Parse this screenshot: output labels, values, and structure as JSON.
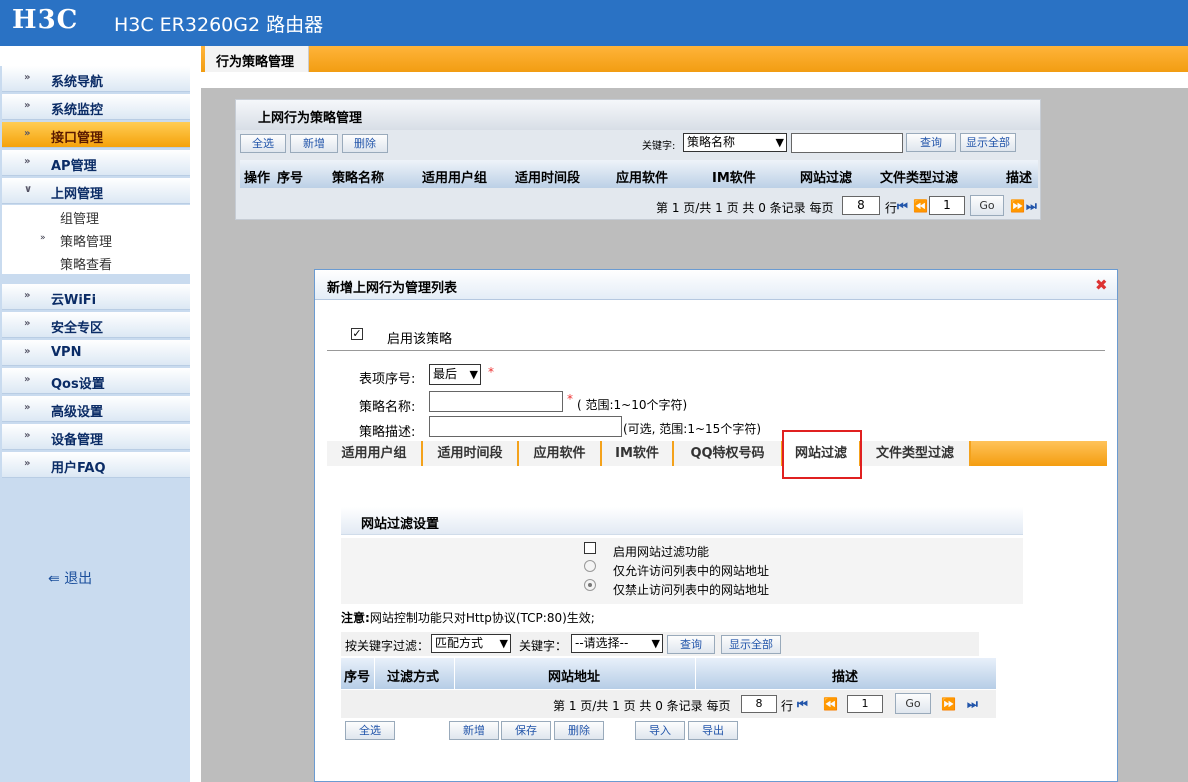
{
  "header": {
    "logo": "H3C",
    "title": "H3C ER3260G2 路由器"
  },
  "sidebar": {
    "items": [
      {
        "label": "系统导航"
      },
      {
        "label": "系统监控"
      },
      {
        "label": "接口管理"
      },
      {
        "label": "AP管理"
      },
      {
        "label": "上网管理"
      },
      {
        "label": "云WiFi"
      },
      {
        "label": "安全专区"
      },
      {
        "label": "VPN"
      },
      {
        "label": "Qos设置"
      },
      {
        "label": "高级设置"
      },
      {
        "label": "设备管理"
      },
      {
        "label": "用户FAQ"
      }
    ],
    "subitems": [
      {
        "label": "组管理"
      },
      {
        "label": "策略管理"
      },
      {
        "label": "策略查看"
      }
    ],
    "logout_label": "退出",
    "accent": "#f5a20b"
  },
  "main": {
    "tab_label": "行为策略管理",
    "panel": {
      "title": "上网行为策略管理",
      "btn_select_all": "全选",
      "btn_add": "新增",
      "btn_delete": "删除",
      "keyword_label": "关键字:",
      "keyword_select": "策略名称",
      "btn_query": "查询",
      "btn_show_all": "显示全部",
      "columns": [
        "操作",
        "序号",
        "策略名称",
        "适用用户组",
        "适用时间段",
        "应用软件",
        "IM软件",
        "网站过滤",
        "文件类型过滤",
        "描述"
      ],
      "pager": {
        "text": "第 1 页/共 1 页 共 0 条记录 每页",
        "per_page": "8",
        "row_label": "行",
        "page_input": "1",
        "go": "Go"
      }
    }
  },
  "dialog": {
    "title": "新增上网行为管理列表",
    "enable_label": "启用该策略",
    "enable_checked": true,
    "field_seq_label": "表项序号:",
    "field_seq_value": "最后",
    "field_name_label": "策略名称:",
    "field_name_hint": "( 范围:1~10个字符)",
    "field_desc_label": "策略描述:",
    "field_desc_hint": "(可选, 范围:1~15个字符)",
    "star": "*",
    "tabs": [
      "适用用户组",
      "适用时间段",
      "应用软件",
      "IM软件",
      "QQ特权号码",
      "网站过滤",
      "文件类型过滤"
    ],
    "active_tab": "网站过滤",
    "section_title": "网站过滤设置",
    "opt_enable": "启用网站过滤功能",
    "opt_allow": "仅允许访问列表中的网站地址",
    "opt_deny": "仅禁止访问列表中的网站地址",
    "note_label": "注意:",
    "note_text": "网站控制功能只对Http协议(TCP:80)生效;",
    "filter_label": "按关键字过滤：",
    "match_select": "匹配方式",
    "keyword_label": "关键字：",
    "keyword_select": "--请选择--",
    "btn_query": "查询",
    "btn_show_all": "显示全部",
    "columns": [
      "序号",
      "过滤方式",
      "网站地址",
      "描述"
    ],
    "pager": {
      "text": "第 1 页/共 1 页 共 0 条记录 每页",
      "per_page": "8",
      "row_label": "行",
      "page_input": "1",
      "go": "Go"
    },
    "buttons": {
      "select_all": "全选",
      "add": "新增",
      "save": "保存",
      "delete": "删除",
      "import": "导入",
      "export": "导出"
    }
  }
}
